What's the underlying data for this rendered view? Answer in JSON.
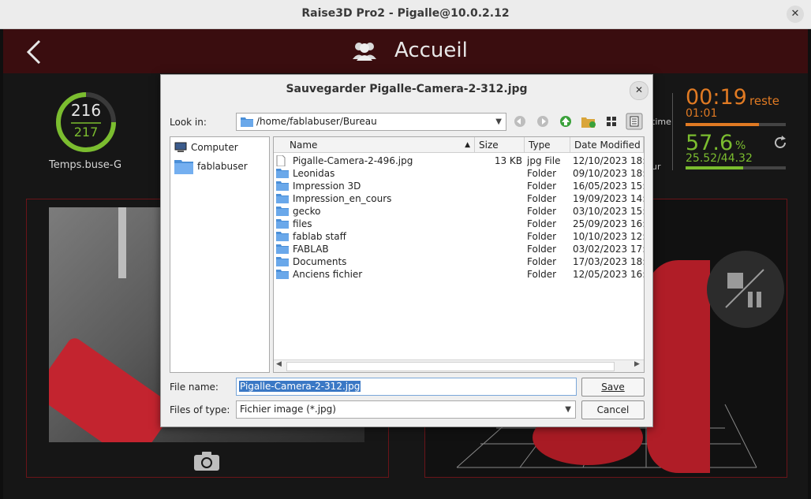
{
  "window": {
    "title": "Raise3D Pro2 - Pigalle@10.0.2.12",
    "close_glyph": "✕"
  },
  "header": {
    "title": "Accueil"
  },
  "nozzle": {
    "current": "216",
    "target": "217",
    "label": "Temps.buse-G"
  },
  "progress": {
    "time_remaining": "00:19",
    "remaining_label": "reste",
    "elapsed": "01:01",
    "time_progress": 0.73,
    "percent": "57.6",
    "percent_unit": "%",
    "layers": "25.52/44.32",
    "percent_progress": 0.576,
    "partial_label_1": "time",
    "partial_label_2": "ur"
  },
  "dialog": {
    "title": "Sauvegarder Pigalle-Camera-2-312.jpg",
    "close_glyph": "✕",
    "look_in_label": "Look in:",
    "look_in_path": "/home/fablabuser/Bureau",
    "places": [
      {
        "label": "Computer",
        "icon": "computer-icon"
      },
      {
        "label": "fablabuser",
        "icon": "home-folder-icon"
      }
    ],
    "columns": {
      "name": "Name",
      "size": "Size",
      "type": "Type",
      "date": "Date Modified"
    },
    "files": [
      {
        "name": "Pigalle-Camera-2-496.jpg",
        "size": "13 KB",
        "type": "jpg File",
        "date": "12/10/2023 18:",
        "icon": "file-icon"
      },
      {
        "name": "Leonidas",
        "size": "",
        "type": "Folder",
        "date": "09/10/2023 18:",
        "icon": "folder-icon"
      },
      {
        "name": "Impression 3D",
        "size": "",
        "type": "Folder",
        "date": "16/05/2023 15:",
        "icon": "folder-icon"
      },
      {
        "name": "Impression_en_cours",
        "size": "",
        "type": "Folder",
        "date": "19/09/2023 14:",
        "icon": "folder-icon"
      },
      {
        "name": "gecko",
        "size": "",
        "type": "Folder",
        "date": "03/10/2023 15:",
        "icon": "folder-icon"
      },
      {
        "name": "files",
        "size": "",
        "type": "Folder",
        "date": "25/09/2023 16:",
        "icon": "folder-icon"
      },
      {
        "name": "fablab staff",
        "size": "",
        "type": "Folder",
        "date": "10/10/2023 12:",
        "icon": "folder-icon"
      },
      {
        "name": "FABLAB",
        "size": "",
        "type": "Folder",
        "date": "03/02/2023 17:",
        "icon": "folder-icon"
      },
      {
        "name": "Documents",
        "size": "",
        "type": "Folder",
        "date": "17/03/2023 18:",
        "icon": "folder-icon"
      },
      {
        "name": "Anciens fichier",
        "size": "",
        "type": "Folder",
        "date": "12/05/2023 16:",
        "icon": "folder-icon"
      }
    ],
    "file_name_label": "File name:",
    "file_name_value": "Pigalle-Camera-2-312.jpg",
    "files_of_type_label": "Files of type:",
    "files_of_type_value": "Fichier image (*.jpg)",
    "save_label": "Save",
    "cancel_label": "Cancel"
  },
  "colors": {
    "accent_orange": "#e07a23",
    "accent_green": "#7bbd2f",
    "header_red": "#3a0d0f"
  }
}
